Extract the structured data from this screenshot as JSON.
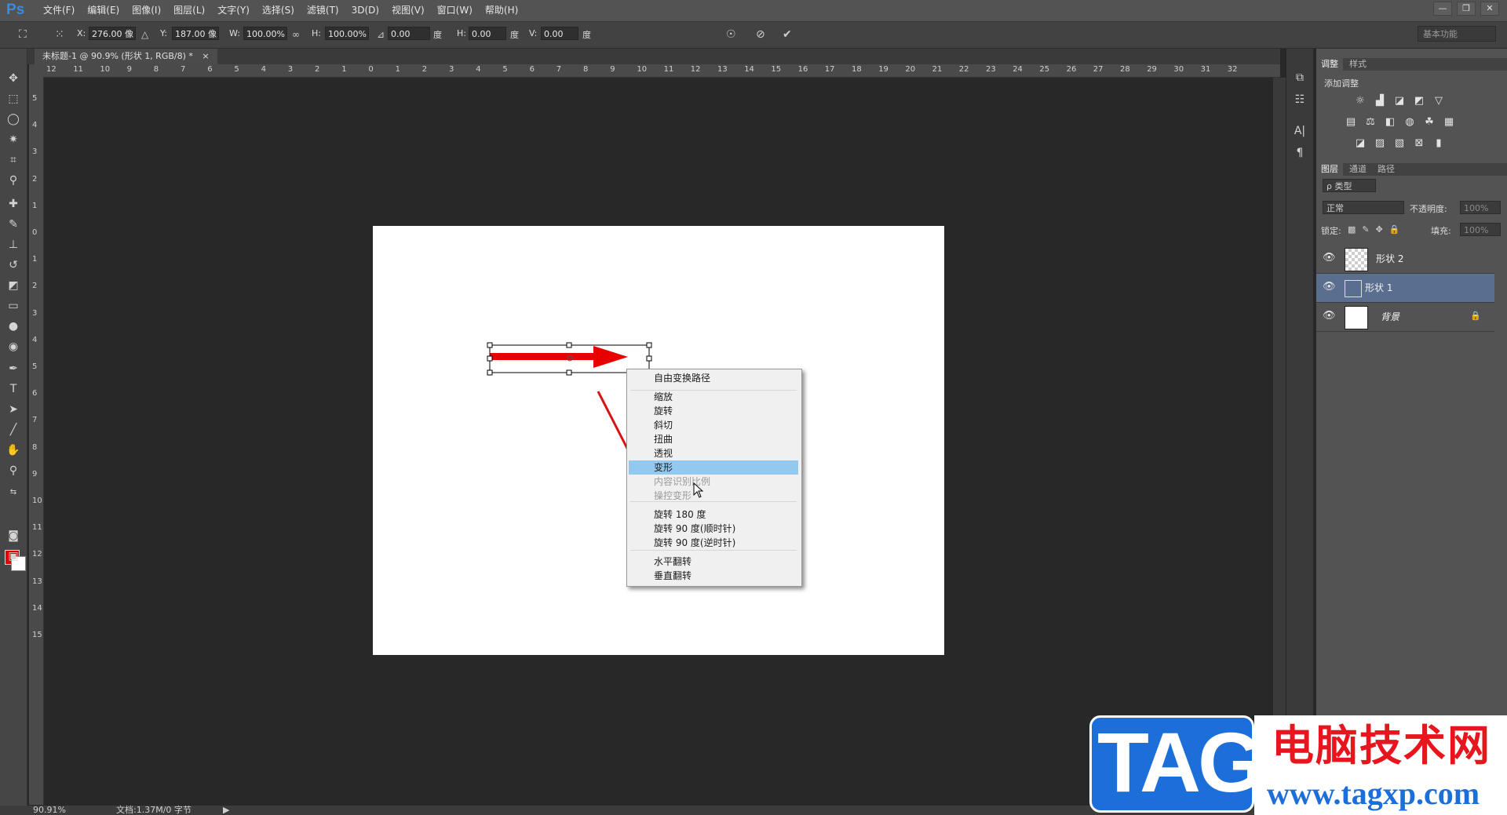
{
  "app": {
    "logo": "Ps",
    "menu": [
      "文件(F)",
      "编辑(E)",
      "图像(I)",
      "图层(L)",
      "文字(Y)",
      "选择(S)",
      "滤镜(T)",
      "3D(D)",
      "视图(V)",
      "窗口(W)",
      "帮助(H)"
    ],
    "window_controls": [
      "—",
      "❐",
      "✕"
    ]
  },
  "options": {
    "x_label": "X:",
    "x_value": "276.00 像",
    "y_label": "Y:",
    "y_value": "187.00 像",
    "w_label": "W:",
    "w_value": "100.00%",
    "h_label": "H:",
    "h_value": "100.00%",
    "angle_value": "0.00",
    "angle_unit": "度",
    "hskew_label": "H:",
    "hskew_value": "0.00",
    "hskew_unit": "度",
    "vskew_label": "V:",
    "vskew_value": "0.00",
    "vskew_unit": "度",
    "workspace": "基本功能"
  },
  "document": {
    "tab_title": "未标题-1 @ 90.9% (形状 1, RGB/8) *",
    "tab_close": "×"
  },
  "rulers": {
    "h_labels": [
      "12",
      "11",
      "10",
      "9",
      "8",
      "7",
      "6",
      "5",
      "4",
      "3",
      "2",
      "1",
      "0",
      "1",
      "2",
      "3",
      "4",
      "5",
      "6",
      "7",
      "8",
      "9",
      "10",
      "11",
      "12",
      "13",
      "14",
      "15",
      "16",
      "17",
      "18",
      "19",
      "20",
      "21",
      "22",
      "23",
      "24",
      "25",
      "26",
      "27",
      "28",
      "29",
      "30",
      "31",
      "32"
    ],
    "v_labels": [
      "5",
      "4",
      "3",
      "2",
      "1",
      "0",
      "1",
      "2",
      "3",
      "4",
      "5",
      "6",
      "7",
      "8",
      "9",
      "10",
      "11",
      "12",
      "13",
      "14",
      "15"
    ]
  },
  "context_menu": {
    "items": [
      {
        "label": "自由变换路径",
        "enabled": true
      },
      {
        "label": "缩放",
        "enabled": true
      },
      {
        "label": "旋转",
        "enabled": true
      },
      {
        "label": "斜切",
        "enabled": true
      },
      {
        "label": "扭曲",
        "enabled": true
      },
      {
        "label": "透视",
        "enabled": true
      },
      {
        "label": "变形",
        "enabled": true,
        "highlighted": true
      },
      {
        "label": "内容识别比例",
        "enabled": false
      },
      {
        "label": "操控变形",
        "enabled": false
      },
      {
        "label": "旋转 180 度",
        "enabled": true
      },
      {
        "label": "旋转 90 度(顺时针)",
        "enabled": true
      },
      {
        "label": "旋转 90 度(逆时针)",
        "enabled": true
      },
      {
        "label": "水平翻转",
        "enabled": true
      },
      {
        "label": "垂直翻转",
        "enabled": true
      }
    ]
  },
  "status": {
    "zoom": "90.91%",
    "doc_info": "文档:1.37M/0 字节"
  },
  "panels": {
    "adjust_tabs": [
      "调整",
      "样式"
    ],
    "add_adjustment": "添加调整",
    "layers_tabs": [
      "图层",
      "通道",
      "路径"
    ],
    "kind_filter": "ρ 类型",
    "blend_mode": "正常",
    "opacity_label": "不透明度:",
    "opacity_value": "100%",
    "lock_label": "锁定:",
    "fill_label": "填充:",
    "fill_value": "100%",
    "layers": [
      {
        "name": "形状 2",
        "selected": false
      },
      {
        "name": "形状 1",
        "selected": true
      },
      {
        "name": "背景",
        "selected": false,
        "locked": true
      }
    ]
  },
  "watermark": {
    "tag": "TAG",
    "cn_text": "电脑技术网",
    "url": "www.tagxp.com"
  },
  "colors": {
    "foreground": "#e80000",
    "background": "#ffffff",
    "arrow": "#e80000",
    "highlight": "#94c9ef",
    "watermark_blue": "#1c6fd8",
    "watermark_red": "#e8141e"
  }
}
